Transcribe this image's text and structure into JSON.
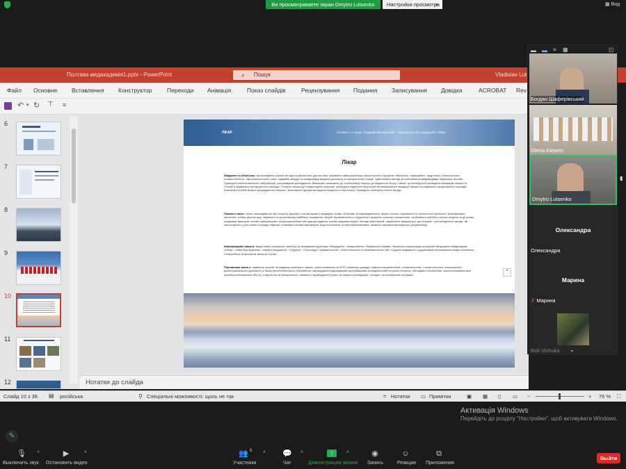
{
  "zoom_top": {
    "share_banner": "Ви просматриваете экран Dmytro Lutsenko",
    "view_settings": "Настройки просмотра",
    "view_btn": "Вид"
  },
  "ppt": {
    "file_title": "Полтава медакадемія1.pptx  -  PowerPoint",
    "search_placeholder": "Пошук",
    "user": "Vladislav Lut",
    "tabs": [
      "Файл",
      "Основне",
      "Вставлення",
      "Конструктор",
      "Переходи",
      "Анімація",
      "Показ слайдів",
      "Рецензування",
      "Подання",
      "Записування",
      "Довідка",
      "ACROBAT",
      "Rev"
    ],
    "slide_numbers": [
      "6",
      "7",
      "8",
      "9",
      "10",
      "11",
      "12"
    ],
    "notes_label": "Нотатки до слайда",
    "status": {
      "slide_info": "Слайд 10 з 36",
      "language": "російська",
      "accessibility": "Спеціальні можливості: щось не так",
      "notes_btn": "Нотатки",
      "comments_btn": "Примітки",
      "zoom_level": "76 %"
    }
  },
  "slide": {
    "header_left": "ЛІКАР",
    "header_crumbs": "Головна > Станція \"Академік Вернадський\" > Інформація для кандидатів > Лікар",
    "title": "Лікар",
    "paragraphs": [
      {
        "label": "Завдання та обов'язки:",
        "text": "застосовувати сучасні методи профілактики, діагностики, лікування найпоширеніших хвороб різного профілю: внутрішніх, інфекційних, хірургічних, гінекологічних, стоматологічних, офтальмологічних тощо; надавати швидку та невідкладну медичну допомогу на антарктичній Станції. Здійснювати нагляд за побічними реакціями/діями лікарських засобів. Проводити загальноклінічні, лабораторні, ультразвукові дослідження. Визначати показання до госпіталізації хворого до медичного блоку Станції, за необхідності проводити евакуацію хворого зі Станції в лікувально-профілактичні заклади. Готувати хворих до невідкладних операцій, проводити хірургічне втручання за неможливості евакуації хворого в лікувально-профілактичні заклади. Визначати ступінь втрати працездатності хворого. Виконувати функції молодшого медичного персоналу. Проводити санітарно-освітні заходи."
      },
      {
        "label": "Повинен знати:",
        "text": "чинне законодавство про охорону здоров'я; основи права в медицині; права, обов'язки та відповідальність лікаря; основи нормальної та патологічної фізіології; класифікацію, патогенез, клініку, діагностику, лікування та профілактику найбільш поширених хвороб терапевтичного і хірургічного профілю; клінічну токсикологію, особливості перебігу гострих отруєнь за дії різних шкідливих факторів; основи лабораторних та функціональних методів досліджень; основи фармакотерапії; методи фізіотерапії, лікувальної фізкультури, дієтотерапії; протиепідемічні заходи, які застосовують у разі появи осередку інфекції; плановані основи харчування, водопостачання та життєзабезпечення; правила оформлення медичної документації."
      },
      {
        "label": "Кваліфікаційні вимоги:",
        "text": "вища освіта (спеціаліст, магістр) за напрямком підготовки «Медицина», спеціальністю «Лікувальна справа». Вітається спеціалізація за фахом «Медицина невідкладних станів», «Загальна практика – сімейна медицина», «Хірургія», «Ортопедія і травматологія», «Анестезіологія та реаніматологія» або «Судова медицина» з додатковим сертифікатом лікаря-терапевта. Стаж роботи за фахом не менш як 3 роки."
      },
      {
        "label": "Перевагами також є:",
        "text": "наявність ліцензії на медичну практику в лікарні, зареєстрованого як ФОП; наявність досвіду і навичок терапевтичної, стоматологічної, стоматологічної, психологічної, фізіотерапевтичної допомоги, а також рентгенологічного обстеження; підтвердженні відповідними сертифікатами; володіння комп'ютерною технікою і методами статобробки; знання іноземних мов (англійської/іспанської або ін.) з акцентом на спеціальність; наявність підтвердженої участі як лікаря в експедиціях, походах, екстремальних ситуаціях."
      }
    ]
  },
  "gallery": {
    "participants": [
      {
        "name": "Богдан Шаферівський"
      },
      {
        "name": "Olena Klepets"
      },
      {
        "name": "Dmytro Lutsenko"
      },
      {
        "name": "Олександра",
        "big": "Олександра"
      },
      {
        "name": "Марина",
        "big": "Марина"
      },
      {
        "name": "Roli Vichuka"
      }
    ]
  },
  "windows_activation": {
    "title": "Активація Windows",
    "text": "Перейдіть до розділу \"Настройки\", щоб активувати Windows."
  },
  "zoom_toolbar": {
    "mute": "Выключить звук",
    "video": "Остановить видео",
    "participants": "Участники",
    "participants_count": "9",
    "chat": "Чат",
    "share": "Демонстрация экрана",
    "record": "Запись",
    "reactions": "Реакции",
    "apps": "Приложения",
    "leave": "Выйти"
  }
}
